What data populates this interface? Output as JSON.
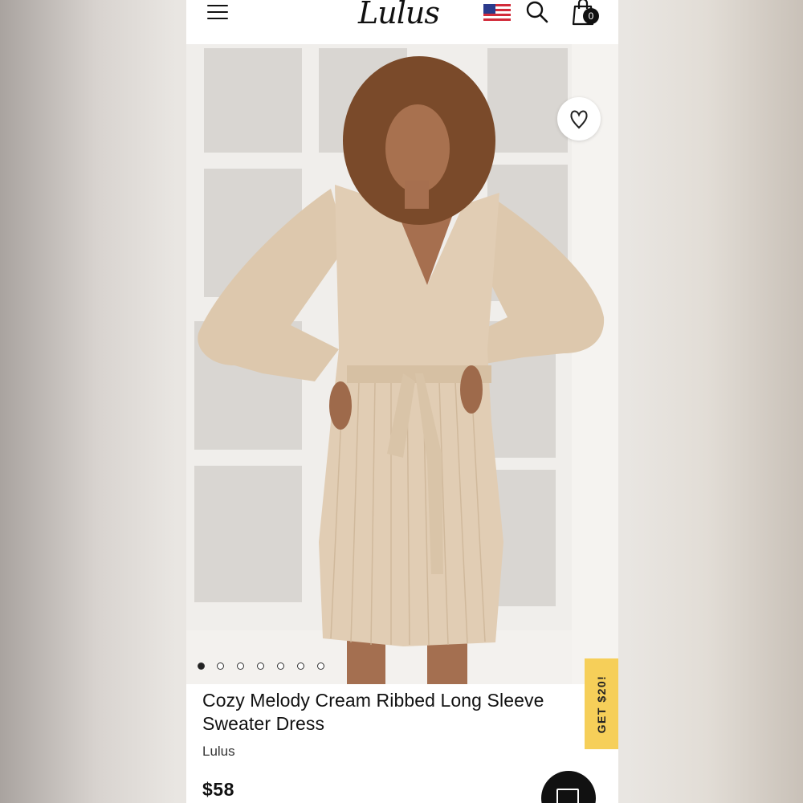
{
  "header": {
    "logo_text": "Lulus",
    "cart_count": "0",
    "icons": [
      "menu-icon",
      "us-flag-icon",
      "search-icon",
      "shopping-bag-icon"
    ]
  },
  "gallery": {
    "image_count": 7,
    "active_index": 0,
    "favorite_icon": "heart-icon"
  },
  "product": {
    "title": "Cozy Melody Cream Ribbed Long Sleeve Sweater Dress",
    "title_line1": "Cozy Melody Cream Ribbed Long Sleeve",
    "title_line2": "Sweater Dress",
    "brand": "Lulus",
    "price": "$58"
  },
  "promo": {
    "label": "GET $20!",
    "color": "#f6cf59"
  },
  "chat": {
    "icon": "chat-icon"
  },
  "colors": {
    "dress": "#e1cdb4",
    "window_frame": "#f2f0ed"
  }
}
